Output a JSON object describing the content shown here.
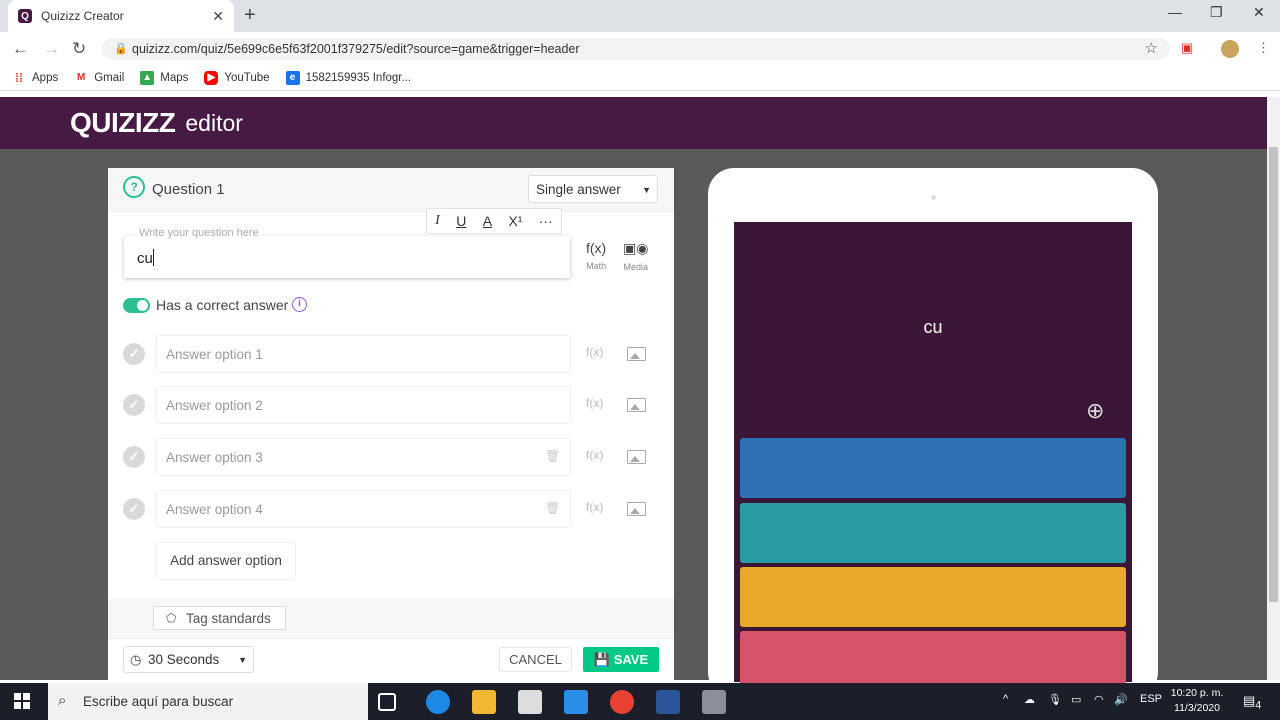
{
  "browser": {
    "tab_title": "Quizizz Creator",
    "tab_icon_letter": "Q",
    "url": "quizizz.com/quiz/5e699c6e5f63f2001f379275/edit?source=game&trigger=header"
  },
  "bookmarks": [
    {
      "label": "Apps",
      "color": "#e94235"
    },
    {
      "label": "Gmail",
      "color": "#d93025"
    },
    {
      "label": "Maps",
      "color": "#34a853"
    },
    {
      "label": "YouTube",
      "color": "#ff0000"
    },
    {
      "label": "1582159935 Infogr...",
      "color": "#1a73e8"
    }
  ],
  "header": {
    "logo": "QUIZIZZ",
    "subtitle": "editor"
  },
  "question": {
    "title": "Question 1",
    "type": "Single answer",
    "placeholder": "Write your question here",
    "value": "cu",
    "math_label": "Math",
    "media_label": "Media",
    "correct_label": "Has a correct answer"
  },
  "answers": [
    {
      "placeholder": "Answer option 1"
    },
    {
      "placeholder": "Answer option 2"
    },
    {
      "placeholder": "Answer option 3"
    },
    {
      "placeholder": "Answer option 4"
    }
  ],
  "add_option": "Add answer option",
  "tag_standards": "Tag standards",
  "timer": "30 Seconds",
  "cancel": "CANCEL",
  "save": "SAVE",
  "preview": {
    "question": "cu",
    "option_colors": [
      "#2d70b3",
      "#2a9ca6",
      "#e9a92a",
      "#d5546a"
    ]
  },
  "taskbar": {
    "search": "Escribe aquí para buscar",
    "lang": "ESP",
    "time": "10:20 p. m.",
    "date": "11/3/2020",
    "notifications": "4"
  }
}
